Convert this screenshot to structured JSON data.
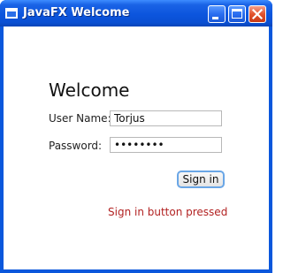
{
  "window": {
    "title": "JavaFX Welcome"
  },
  "form": {
    "heading": "Welcome",
    "username_label": "User Name:",
    "username_value": "Torjus",
    "password_label": "Password:",
    "password_value": "••••••••",
    "signin_label": "Sign in",
    "status_message": "Sign in button pressed"
  },
  "colors": {
    "titlebar": "#0a57dc",
    "status_text": "#b22222"
  },
  "icons": {
    "app": "app-window-icon",
    "minimize": "minimize-icon",
    "maximize": "maximize-icon",
    "close": "close-icon"
  }
}
